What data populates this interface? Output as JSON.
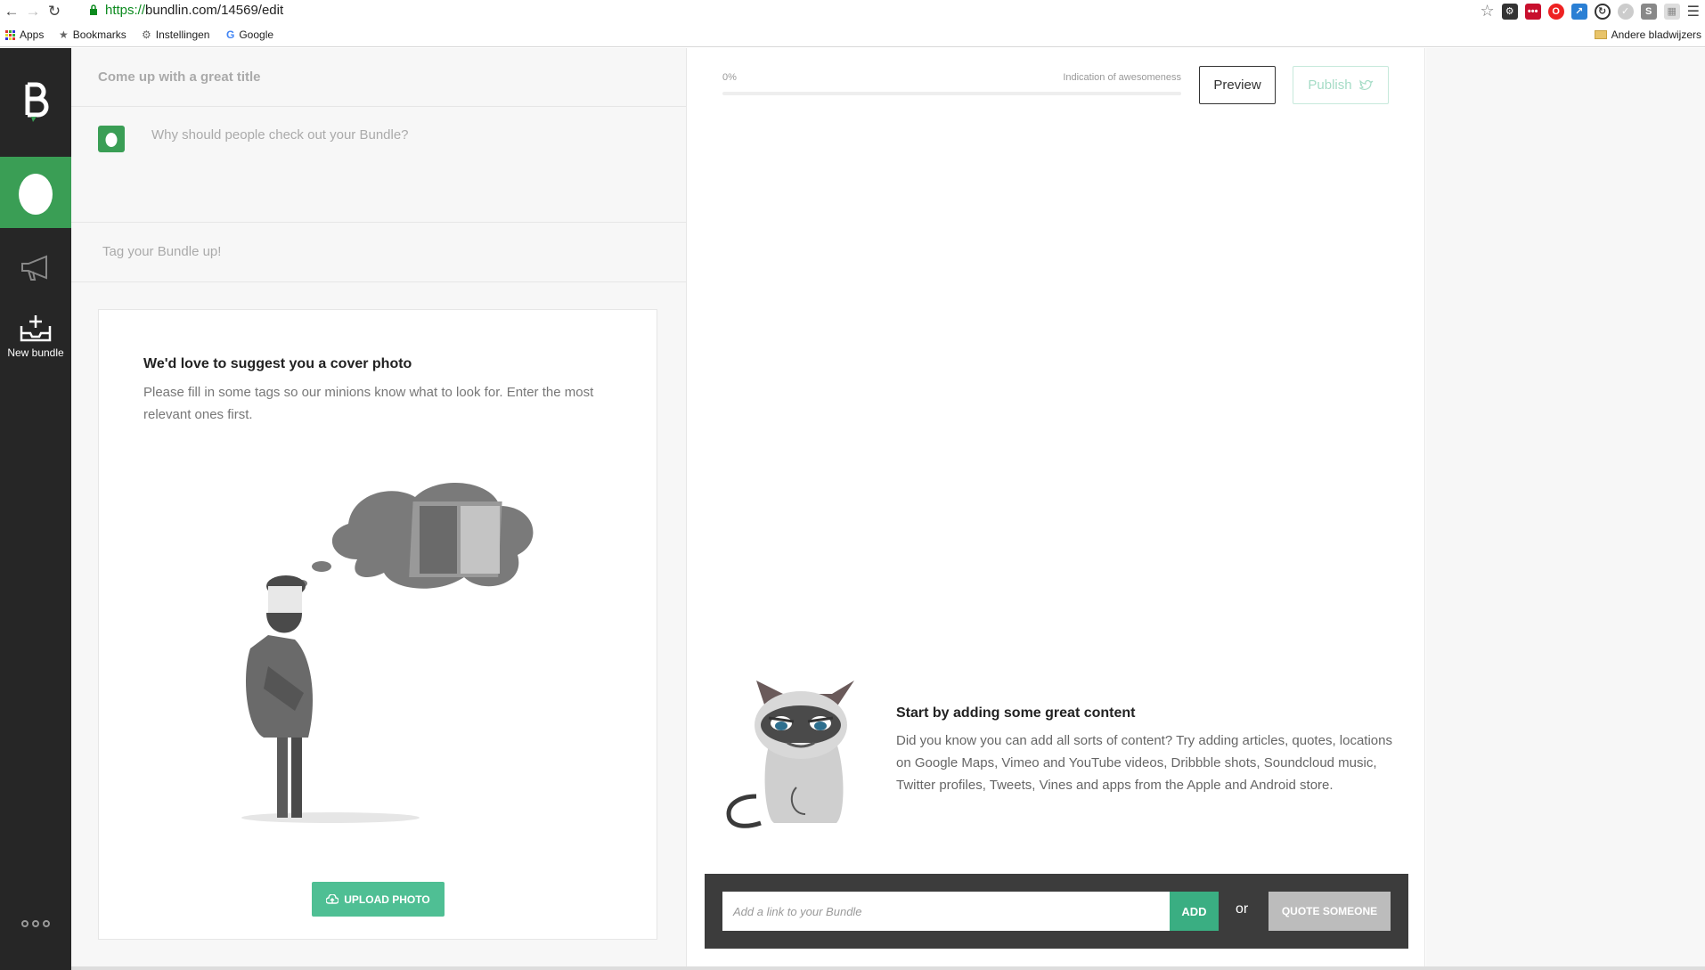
{
  "browser": {
    "url_scheme": "https://",
    "url_rest": "bundlin.com/14569/edit",
    "bookmarks": [
      "Apps",
      "Bookmarks",
      "Instellingen",
      "Google"
    ],
    "other_bookmarks": "Andere bladwijzers"
  },
  "sidebar": {
    "new_bundle_label": "New bundle"
  },
  "editor": {
    "title_placeholder": "Come up with a great title",
    "description_placeholder": "Why should people check out your Bundle?",
    "tags_placeholder": "Tag your Bundle up!"
  },
  "cover": {
    "title": "We'd love to suggest you a cover photo",
    "text": "Please fill in some tags so our minions know what to look for. Enter the most relevant ones first.",
    "upload_label": "UPLOAD PHOTO"
  },
  "progress": {
    "percent_label": "0%",
    "percent_value": 0,
    "label": "Indication of awesomeness"
  },
  "actions": {
    "preview_label": "Preview",
    "publish_label": "Publish"
  },
  "content": {
    "title": "Start by adding some great content",
    "text": "Did you know you can add all sorts of content? Try adding articles, quotes, locations on Google Maps, Vimeo and YouTube videos, Dribbble shots, Soundcloud music, Twitter profiles, Tweets, Vines and apps from the Apple and Android store."
  },
  "add_bar": {
    "input_placeholder": "Add a link to your Bundle",
    "add_label": "ADD",
    "or_label": "or",
    "quote_label": "QUOTE SOMEONE"
  },
  "colors": {
    "accent": "#3a9e55",
    "teal": "#4fbf94",
    "sidebar": "#262626"
  }
}
